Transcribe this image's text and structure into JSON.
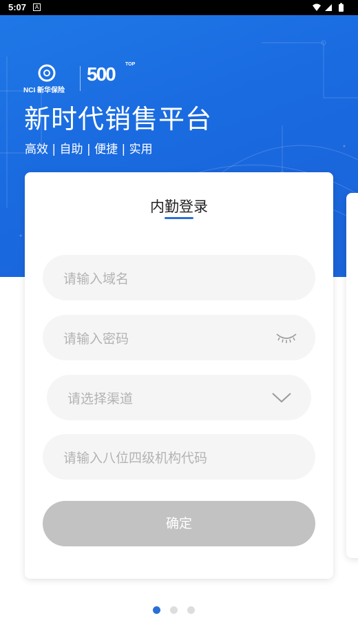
{
  "status_bar": {
    "time": "5:07",
    "app_icon": "A"
  },
  "hero": {
    "logo_text": "NCI 新华保险",
    "badge_number": "500",
    "badge_top": "TOP",
    "title": "新时代销售平台",
    "subtitle": "高效 | 自助 | 便捷 | 实用"
  },
  "login": {
    "title": "内勤登录",
    "domain_placeholder": "请输入域名",
    "password_placeholder": "请输入密码",
    "channel_placeholder": "请选择渠道",
    "org_code_placeholder": "请输入八位四级机构代码",
    "confirm_label": "确定"
  },
  "pager": {
    "total": 3,
    "active": 1
  },
  "colors": {
    "hero_blue": "#1f78e6",
    "accent": "#2a6fd6",
    "button_disabled": "#c2c2c2",
    "field_bg": "#f5f5f5"
  },
  "icons": {
    "password_toggle": "eye-closed-icon",
    "channel_dropdown": "chevron-down-icon",
    "status_wifi": "wifi-icon",
    "status_signal": "signal-icon",
    "status_battery": "battery-icon"
  }
}
